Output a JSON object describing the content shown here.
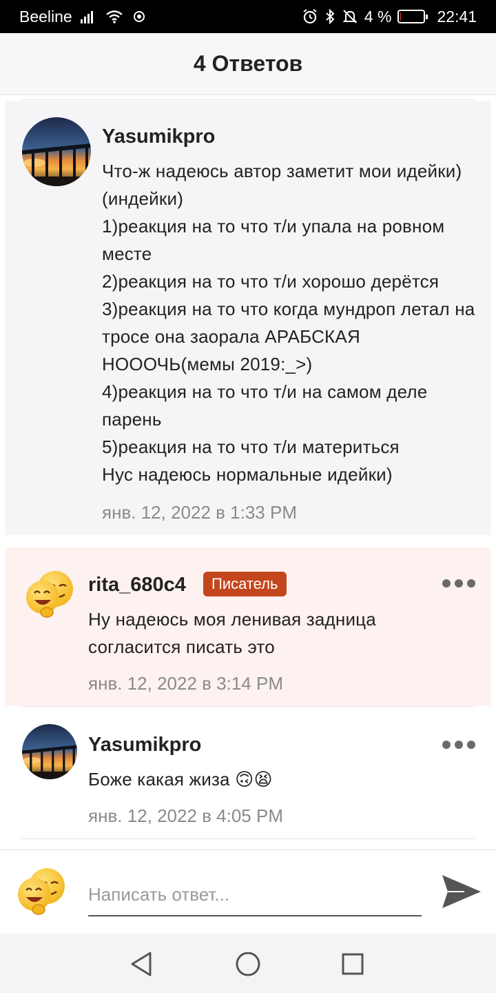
{
  "status_bar": {
    "carrier": "Beeline",
    "battery_text": "4 %",
    "battery_level": 0.04,
    "time": "22:41"
  },
  "header": {
    "title": "4 Ответов"
  },
  "comments": [
    {
      "author": "Yasumikpro",
      "text": "Что-ж надеюсь автор заметит мои идейки)(индейки)\n1)реакция на то что т/и упала на ровном месте\n2)реакция на то что т/и хорошо дерётся\n3)реакция на то что когда мундроп летал на тросе она заорала АРАБСКАЯ НОООЧЬ(мемы 2019:_>)\n4)реакция на то что т/и на самом деле парень\n5)реакция на то что т/и материться\nНус надеюсь нормальные идейки)",
      "timestamp": "янв. 12, 2022 в 1:33 PM"
    },
    {
      "author": "rita_680c4",
      "badge": "Писатель",
      "text": "Ну надеюсь моя ленивая задница согласится писать это",
      "timestamp": "янв. 12, 2022 в 3:14 PM"
    },
    {
      "author": "Yasumikpro",
      "text": "Боже какая жиза 🙃😫",
      "timestamp": "янв. 12, 2022 в 4:05 PM"
    }
  ],
  "reply": {
    "placeholder": "Написать ответ..."
  },
  "icons": {
    "signal": "signal-icon",
    "wifi": "wifi-icon",
    "alarm": "alarm-icon",
    "bluetooth": "bluetooth-icon",
    "mute": "bell-off-icon",
    "more": "more-icon",
    "send": "send-icon",
    "nav_back": "back-triangle-icon",
    "nav_home": "home-circle-icon",
    "nav_recent": "recent-square-icon"
  },
  "colors": {
    "badge": "#c4461d",
    "highlight_bg": "#fdf2ef",
    "parent_bg": "#f5f5f7",
    "battery_low": "#e53935"
  }
}
